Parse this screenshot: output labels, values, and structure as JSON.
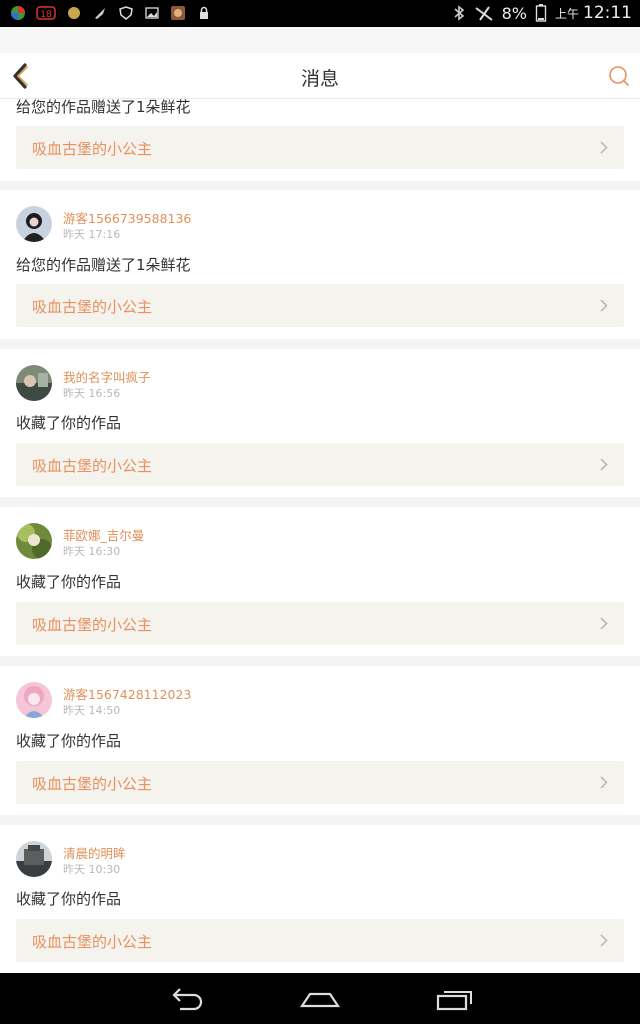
{
  "status_bar": {
    "battery": "8%",
    "ampm": "上午",
    "time": "12:11"
  },
  "header": {
    "title": "消息"
  },
  "messages": [
    {
      "message": "给您的作品赠送了1朵鲜花",
      "work": "吸血古堡的小公主"
    },
    {
      "user": "游客1566739588136",
      "time": "昨天 17:16",
      "message": "给您的作品赠送了1朵鲜花",
      "work": "吸血古堡的小公主"
    },
    {
      "user": "我的名字叫疯子",
      "time": "昨天 16:56",
      "message": "收藏了你的作品",
      "work": "吸血古堡的小公主"
    },
    {
      "user": "菲欧娜_吉尔曼",
      "time": "昨天 16:30",
      "message": "收藏了你的作品",
      "work": "吸血古堡的小公主"
    },
    {
      "user": "游客1567428112023",
      "time": "昨天 14:50",
      "message": "收藏了你的作品",
      "work": "吸血古堡的小公主"
    },
    {
      "user": "清晨的明眸",
      "time": "昨天 10:30",
      "message": "收藏了你的作品",
      "work": "吸血古堡的小公主"
    }
  ],
  "colors": {
    "accent": "#e8905e",
    "work_bg": "#f4f3ed"
  }
}
